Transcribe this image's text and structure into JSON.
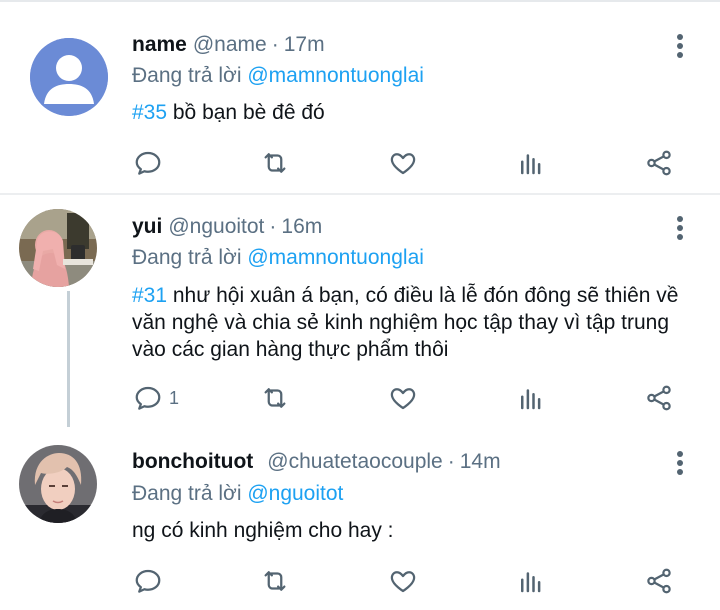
{
  "tweets": [
    {
      "display_name": "name",
      "handle": "@name",
      "time": "17m",
      "reply_prefix": "Đang trả lời",
      "reply_to": "@mamnontuonglai",
      "hashtag": "#35",
      "text": " bồ bạn bè đê đó",
      "reply_count": "",
      "avatar": "default-avatar"
    },
    {
      "display_name": "yui",
      "handle": "@nguoitot",
      "time": "16m",
      "reply_prefix": "Đang trả lời",
      "reply_to": "@mamnontuonglai",
      "hashtag": "#31",
      "text": " như hội xuân á bạn, có điều là lễ đón đông sẽ thiên về văn nghệ và chia sẻ kinh nghiệm học tập thay vì tập trung vào các gian hàng thực phẩm thôi",
      "reply_count": "1",
      "avatar": "photo-pink-hair"
    },
    {
      "display_name": "bonchoituot",
      "handle": "@chuatetaocouple",
      "time": "14m",
      "reply_prefix": "Đang trả lời",
      "reply_to": "@nguoitot",
      "hashtag": "",
      "text": "ng có kinh nghiệm cho hay :",
      "reply_count": "",
      "avatar": "photo-blond-boy"
    }
  ],
  "separator": "·",
  "icons": [
    "reply-icon",
    "retweet-icon",
    "like-icon",
    "stats-icon",
    "share-icon",
    "more-icon"
  ],
  "colors": {
    "link": "#1da1f2",
    "secondary": "#5b7083",
    "text": "#0f1419"
  }
}
